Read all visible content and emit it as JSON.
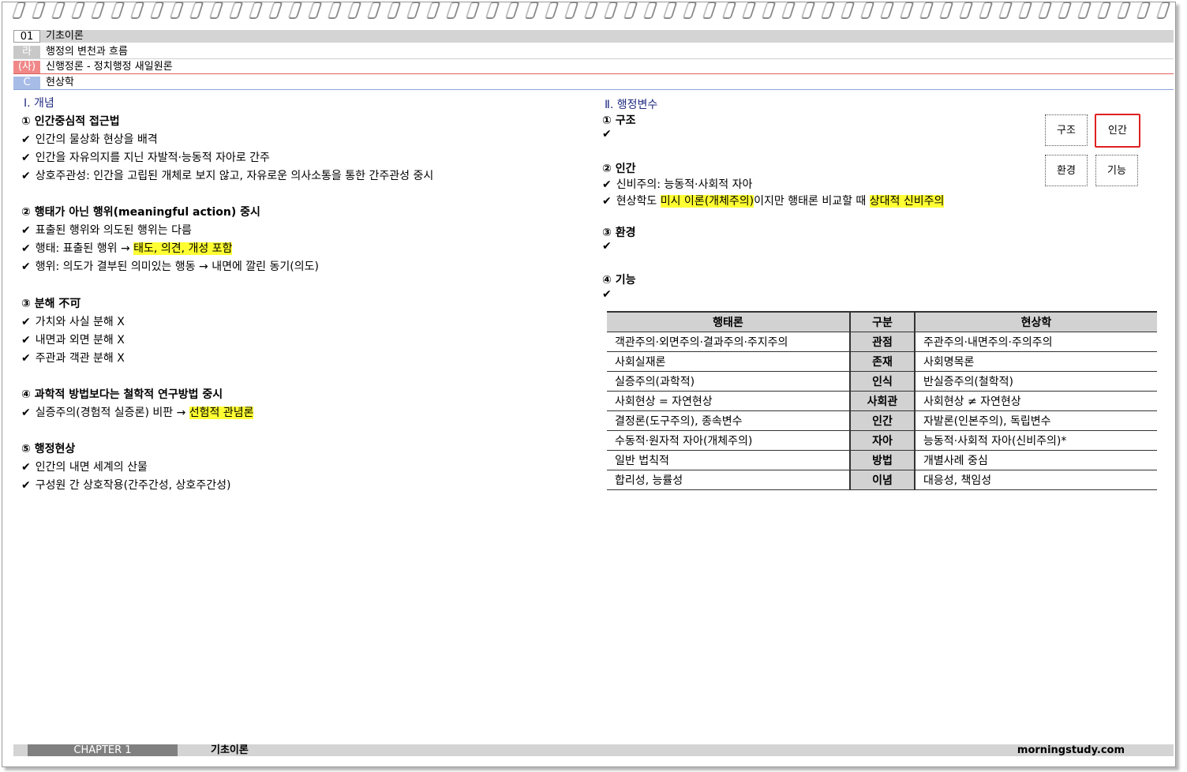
{
  "header": {
    "rows": [
      {
        "tag": "01",
        "text": "기초이론"
      },
      {
        "tag": "라",
        "text": "행정의 변천과 흐름"
      },
      {
        "tag": "(사)",
        "text": "신행정론 - 정치행정 새일원론"
      },
      {
        "tag": "C",
        "text": "현상학"
      }
    ]
  },
  "left": {
    "section_title": "Ⅰ. 개념",
    "groups": [
      {
        "title": "① 인간중심적 접근법",
        "items": [
          "인간의 물상화 현상을 배격",
          "인간을 자유의지를 지닌 자발적·능동적 자아로 간주",
          "상호주관성: 인간을 고립된 개체로 보지 않고, 자유로운 의사소통을 통한 간주관성 중시"
        ]
      },
      {
        "title": "② 행태가 아닌 행위(meaningful action) 중시",
        "items": [
          "표출된 행위와 의도된 행위는 다름",
          {
            "text": "행태: 표출된 행위  →  ",
            "highlight": "태도, 의견, 개성 포함"
          },
          "행위: 의도가 결부된 의미있는 행동 → 내면에 깔린 동기(의도)"
        ]
      },
      {
        "title": "③ 분해 不可",
        "items": [
          "가치와 사실 분해 X",
          "내면과 외면 분해 X",
          "주관과 객관 분해 X"
        ]
      },
      {
        "title": "④ 과학적 방법보다는 철학적 연구방법 중시",
        "items": [
          {
            "text": "실증주의(경험적 실증론) 비판 → ",
            "highlight": "선험적 관념론"
          }
        ]
      },
      {
        "title": "⑤ 행정현상",
        "items": [
          "인간의 내면 세계의 산물",
          "구성원 간 상호작용(간주간성, 상호주간성)"
        ]
      }
    ]
  },
  "right": {
    "section_title": "Ⅱ. 행정변수",
    "checkmark": "✔",
    "g1_title": "① 구조",
    "g2_title": "② 인간",
    "g2_item1": "신비주의: 능동적·사회적 자아",
    "g2_item2_a": "현상학도 ",
    "g2_item2_hl1": "미시 이론(개체주의)",
    "g2_item2_b": "이지만 행태론 비교할 때 ",
    "g2_item2_hl2": "상대적 신비주의",
    "g3_title": "③ 환경",
    "g4_title": "④ 기능",
    "boxes": [
      "구조",
      "인간",
      "환경",
      "기능"
    ],
    "selected_box": "인간"
  },
  "table": {
    "headers": [
      "행태론",
      "구분",
      "현상학"
    ],
    "rows": [
      [
        "객관주의·외면주의·결과주의·주지주의",
        "관점",
        "주관주의·내면주의·주의주의"
      ],
      [
        "사회실재론",
        "존재",
        "사회명목론"
      ],
      [
        "실증주의(과학적)",
        "인식",
        "반실증주의(철학적)"
      ],
      [
        "사회현상 = 자연현상",
        "사회관",
        "사회현상 ≠ 자연현상"
      ],
      [
        "결정론(도구주의), 종속변수",
        "인간",
        "자발론(인본주의), 독립변수"
      ],
      [
        "수동적·원자적 자아(개체주의)",
        "자아",
        "능동적·사회적 자아(신비주의)*"
      ],
      [
        "일반 법칙적",
        "방법",
        "개별사례 중심"
      ],
      [
        "합리성, 능률성",
        "이념",
        "대응성, 책임성"
      ]
    ]
  },
  "footer": {
    "chapter": "CHAPTER 1",
    "title": "기초이론",
    "site": "morningstudy.com"
  }
}
